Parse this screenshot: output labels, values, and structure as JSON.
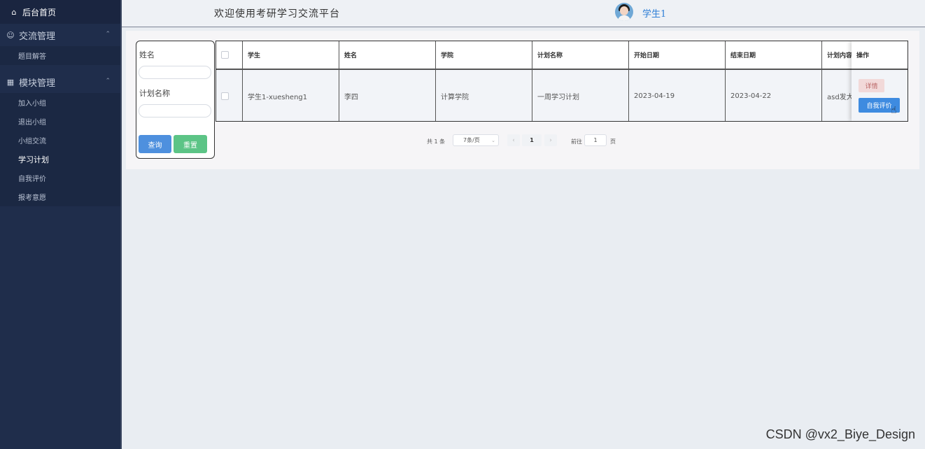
{
  "sidebar": {
    "home": "后台首页",
    "groups": [
      {
        "label": "交流管理",
        "items": [
          "题目解答"
        ]
      },
      {
        "label": "模块管理",
        "items": [
          "加入小组",
          "退出小组",
          "小组交流",
          "学习计划",
          "自我评价",
          "报考意愿"
        ]
      }
    ],
    "active_item": "学习计划"
  },
  "header": {
    "title": "欢迎使用考研学习交流平台",
    "username": "学生1"
  },
  "search": {
    "name_label": "姓名",
    "name_value": "",
    "plan_label": "计划名称",
    "plan_value": "",
    "query_button": "查询",
    "reset_button": "重置"
  },
  "table": {
    "columns": [
      "学生",
      "姓名",
      "学院",
      "计划名称",
      "开始日期",
      "结束日期",
      "计划内容"
    ],
    "action_header": "操作",
    "rows": [
      {
        "student": "学生1-xuesheng1",
        "name": "李四",
        "college": "计算学院",
        "plan_name": "一周学习计划",
        "start_date": "2023-04-19",
        "end_date": "2023-04-22",
        "content": "asd发大"
      }
    ],
    "detail_button": "详情",
    "evaluate_button": "自我评价"
  },
  "pagination": {
    "total_text": "共 1 条",
    "page_size": "7条/页",
    "current_page": "1",
    "goto_label": "前往",
    "goto_value": "1",
    "page_unit": "页"
  },
  "watermark": "CSDN @vx2_Biye_Design"
}
